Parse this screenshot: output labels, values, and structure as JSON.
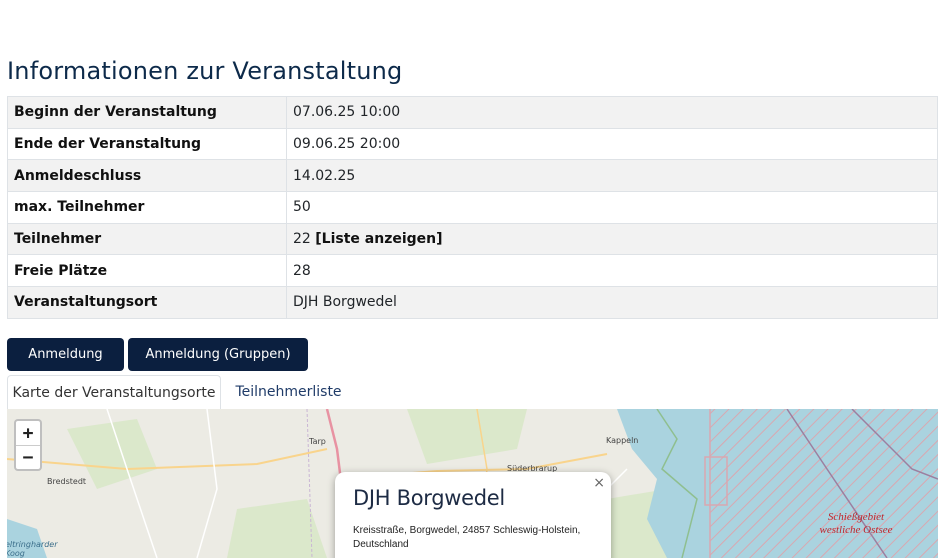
{
  "page": {
    "title": "Informationen zur Veranstaltung"
  },
  "info_table": {
    "rows": [
      {
        "label": "Beginn der Veranstaltung",
        "value": "07.06.25 10:00"
      },
      {
        "label": "Ende der Veranstaltung",
        "value": "09.06.25 20:00"
      },
      {
        "label": "Anmeldeschluss",
        "value": "14.02.25"
      },
      {
        "label": "max. Teilnehmer",
        "value": "50"
      },
      {
        "label": "Teilnehmer",
        "value": "22",
        "link": "[Liste anzeigen]"
      },
      {
        "label": "Freie Plätze",
        "value": "28"
      },
      {
        "label": "Veranstaltungsort",
        "value": "DJH Borgwedel"
      }
    ]
  },
  "buttons": {
    "anmeldung": "Anmeldung",
    "anmeldung_gruppen": "Anmeldung (Gruppen)"
  },
  "tabs": [
    {
      "label": "Karte der Veranstaltungsorte",
      "active": true
    },
    {
      "label": "Teilnehmerliste",
      "active": false
    }
  ],
  "map": {
    "zoom_in": "+",
    "zoom_out": "−",
    "places": {
      "tarp": "Tarp",
      "kappeln": "Kappeln",
      "suederbrarup": "Süderbrarup",
      "bredstedt": "Bredstedt",
      "koog": "eltringharder Koog"
    },
    "restricted_area": "Schießgebiet westliche Ostsee",
    "popup": {
      "title": "DJH Borgwedel",
      "address_line1": "Kreisstraße, Borgwedel, 24857 Schleswig-Holstein,",
      "address_line2": "Deutschland",
      "close": "×"
    },
    "colors": {
      "land": "#ecebe4",
      "sea": "#aad3df",
      "restricted": "#c0262d"
    }
  }
}
